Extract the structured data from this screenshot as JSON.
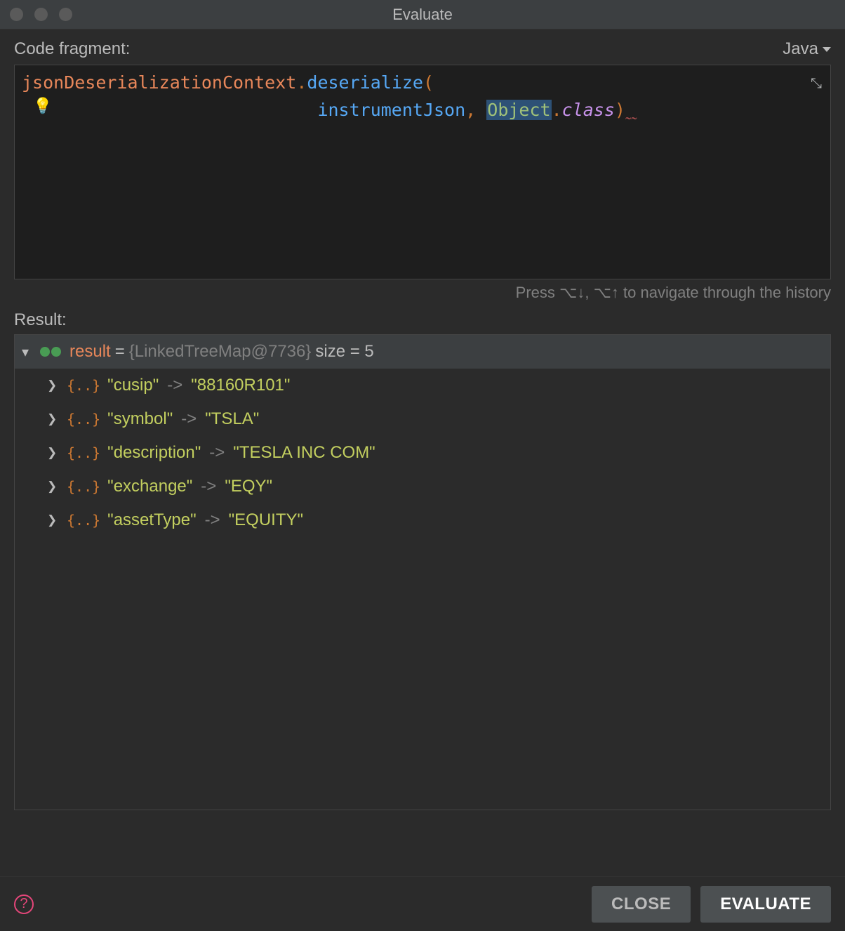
{
  "window": {
    "title": "Evaluate"
  },
  "section": {
    "code_label": "Code fragment:",
    "language": "Java",
    "hint": "Press ⌥↓, ⌥↑ to navigate through the history",
    "result_label": "Result:"
  },
  "code": {
    "line1": {
      "ident": "jsonDeserializationContext",
      "dot": ".",
      "method": "deserialize",
      "paren_open": "("
    },
    "line2_indent": "                            ",
    "line2": {
      "param": "instrumentJson",
      "comma": ", ",
      "obj": "Object",
      "dot": ".",
      "cls": "class",
      "paren_close": ")",
      "err": "˷˷"
    }
  },
  "icons": {
    "bulb": "💡",
    "collapse": "⤡"
  },
  "result": {
    "name": "result",
    "eq": " = ",
    "type": "{LinkedTreeMap@7736}",
    "size": "  size = 5",
    "entries": [
      {
        "key": "\"cusip\"",
        "arrow": "->",
        "value": "\"88160R101\""
      },
      {
        "key": "\"symbol\"",
        "arrow": "->",
        "value": "\"TSLA\""
      },
      {
        "key": "\"description\"",
        "arrow": "->",
        "value": "\"TESLA INC COM\""
      },
      {
        "key": "\"exchange\"",
        "arrow": "->",
        "value": "\"EQY\""
      },
      {
        "key": "\"assetType\"",
        "arrow": "->",
        "value": "\"EQUITY\""
      }
    ]
  },
  "footer": {
    "help": "?",
    "close": "CLOSE",
    "evaluate": "EVALUATE"
  }
}
